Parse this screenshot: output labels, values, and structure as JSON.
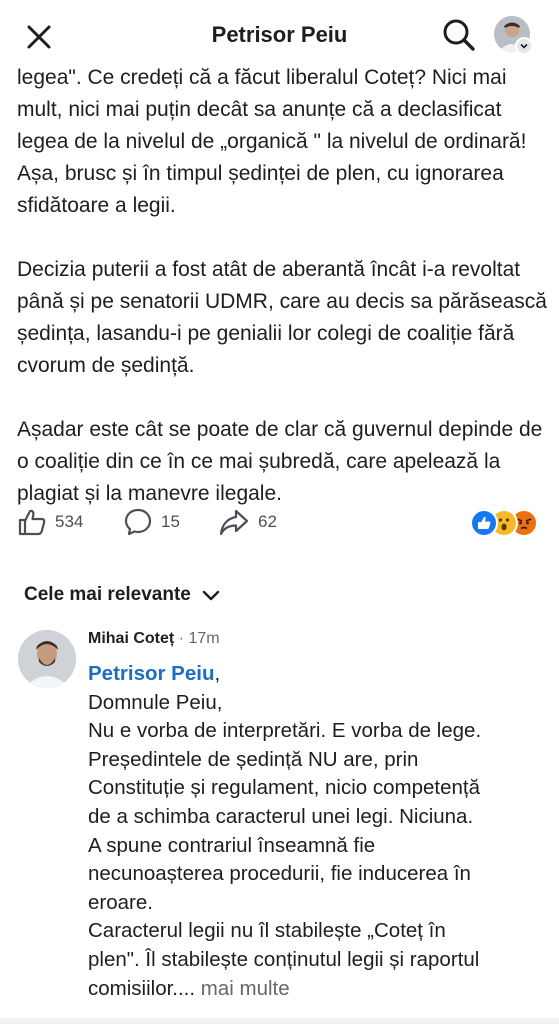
{
  "header": {
    "title": "Petrisor Peiu",
    "close_icon": "close-icon",
    "search_icon": "search-icon",
    "avatar_icon": "profile-avatar"
  },
  "post": {
    "paragraphs": [
      "legea\". Ce credeți că a făcut liberalul Coteț? Nici mai mult, nici mai puțin decât sa anunțe că a declasificat legea de la nivelul de „organică \" la nivelul de ordinară! Așa,  brusc și în timpul ședinței de plen, cu ignorarea sfidătoare a legii.",
      "Decizia puterii a fost atât de aberantă încât i-a revoltat până și pe senatorii UDMR,  care au decis sa părăsească ședința,  lasandu-i pe genialii lor colegi de coaliție fără cvorum de ședință.",
      "Așadar este cât se poate de clar că guvernul depinde de o coaliție din ce în ce mai șubredă, care apelează la plagiat și la manevre ilegale."
    ]
  },
  "reactions": {
    "likes": "534",
    "comments": "15",
    "shares": "62",
    "emoji": [
      "like",
      "wow",
      "angry"
    ],
    "colors": {
      "like": "#1877f2",
      "wow": "#f7b928",
      "angry": "#e9710f"
    }
  },
  "comments_section": {
    "sort_label": "Cele mai relevante"
  },
  "comment": {
    "author": "Mihai Coteț",
    "separator": " · ",
    "time": "17m",
    "mention": "Petrisor Peiu",
    "mention_suffix": ",",
    "lines": [
      "Domnule Peiu,",
      "Nu e vorba de interpretări. E vorba de lege.",
      "Președintele de ședință NU are, prin",
      "Constituție și regulament, nicio competență",
      "de a schimba caracterul unei legi. Niciuna.",
      "A spune contrariul înseamnă fie",
      "necunoașterea procedurii, fie inducerea în",
      "eroare.",
      "Caracterul legii nu îl stabilește „Coteț în",
      "plen\". Îl stabilește conținutul legii și raportul"
    ],
    "last_line": "comisiilor....",
    "more_label": "mai multe"
  },
  "colors": {
    "link": "#1b6ec2",
    "text": "#1c1e21",
    "muted": "#65676b"
  }
}
